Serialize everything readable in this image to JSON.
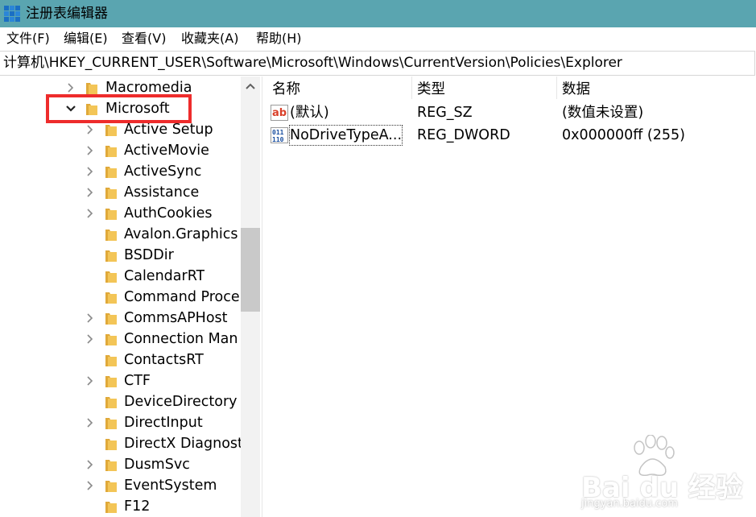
{
  "window": {
    "title": "注册表编辑器"
  },
  "menu": [
    "文件(F)",
    "编辑(E)",
    "查看(V)",
    "收藏夹(A)",
    "帮助(H)"
  ],
  "address": {
    "path": "计算机\\HKEY_CURRENT_USER\\Software\\Microsoft\\Windows\\CurrentVersion\\Policies\\Explorer"
  },
  "tree": {
    "items": [
      {
        "label": "Macromedia",
        "expander": "collapsed"
      },
      {
        "label": "Microsoft",
        "expander": "expanded"
      },
      {
        "label": "Active Setup",
        "expander": "collapsed"
      },
      {
        "label": "ActiveMovie",
        "expander": "collapsed"
      },
      {
        "label": "ActiveSync",
        "expander": "collapsed"
      },
      {
        "label": "Assistance",
        "expander": "collapsed"
      },
      {
        "label": "AuthCookies",
        "expander": "collapsed"
      },
      {
        "label": "Avalon.Graphics",
        "expander": "none"
      },
      {
        "label": "BSDDir",
        "expander": "none"
      },
      {
        "label": "CalendarRT",
        "expander": "none"
      },
      {
        "label": "Command Proce",
        "expander": "none"
      },
      {
        "label": "CommsAPHost",
        "expander": "collapsed"
      },
      {
        "label": "Connection Man",
        "expander": "collapsed"
      },
      {
        "label": "ContactsRT",
        "expander": "none"
      },
      {
        "label": "CTF",
        "expander": "collapsed"
      },
      {
        "label": "DeviceDirectory",
        "expander": "none"
      },
      {
        "label": "DirectInput",
        "expander": "collapsed"
      },
      {
        "label": "DirectX Diagnost",
        "expander": "none"
      },
      {
        "label": "DusmSvc",
        "expander": "collapsed"
      },
      {
        "label": "EventSystem",
        "expander": "collapsed"
      },
      {
        "label": "F12",
        "expander": "none"
      }
    ]
  },
  "list": {
    "columns": {
      "name": "名称",
      "type": "类型",
      "data": "数据"
    },
    "rows": [
      {
        "icon": "string-value-icon",
        "name": "(默认)",
        "type": "REG_SZ",
        "data": "(数值未设置)"
      },
      {
        "icon": "binary-value-icon",
        "name": "NoDriveTypeA...",
        "type": "REG_DWORD",
        "data": "0x000000ff (255)"
      }
    ]
  },
  "watermark": {
    "brand": "Bai du 经验",
    "url": "jingyan.baidu.com"
  },
  "colors": {
    "titlebar": "#5aa5b0",
    "highlight": "#ee2c2c",
    "folder": "#f3c557",
    "scroll_thumb": "#c9c9c9"
  }
}
